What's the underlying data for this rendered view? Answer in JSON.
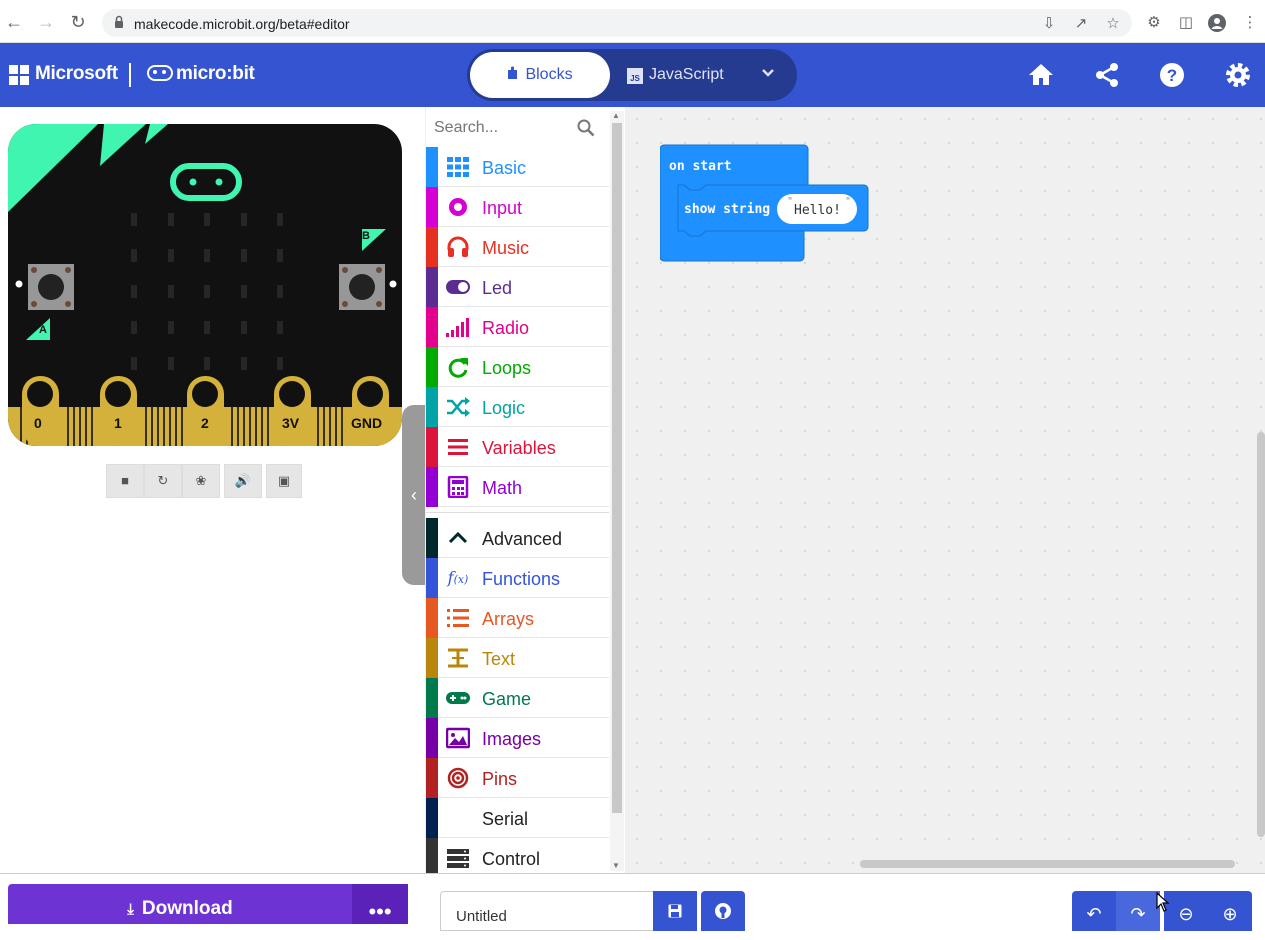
{
  "browser": {
    "url": "makecode.microbit.org/beta#editor"
  },
  "header": {
    "brand": "Microsoft",
    "product": "micro:bit",
    "mode_blocks": "Blocks",
    "mode_js": "JavaScript",
    "js_badge": "JS"
  },
  "simulator": {
    "button_a": "A",
    "button_b": "B",
    "pins": [
      "0",
      "1",
      "2",
      "3V",
      "GND"
    ],
    "accent_color": "#3ff5b0"
  },
  "toolbox": {
    "search_placeholder": "Search...",
    "categories": [
      {
        "label": "Basic",
        "color": "#1e90ff",
        "icon": "grid-icon"
      },
      {
        "label": "Input",
        "color": "#d400d4",
        "icon": "input-icon"
      },
      {
        "label": "Music",
        "color": "#e63022",
        "icon": "headphones-icon"
      },
      {
        "label": "Led",
        "color": "#5c2d91",
        "icon": "toggle-icon"
      },
      {
        "label": "Radio",
        "color": "#e3008c",
        "icon": "signal-icon"
      },
      {
        "label": "Loops",
        "color": "#00aa00",
        "icon": "refresh-icon"
      },
      {
        "label": "Logic",
        "color": "#00a4a6",
        "icon": "shuffle-icon"
      },
      {
        "label": "Variables",
        "color": "#dc143c",
        "icon": "list-icon"
      },
      {
        "label": "Math",
        "color": "#9400d3",
        "icon": "calculator-icon"
      },
      {
        "label": "Advanced",
        "color": "#00272b",
        "icon": "chevron-up-icon"
      },
      {
        "label": "Functions",
        "color": "#3455db",
        "icon": "function-icon"
      },
      {
        "label": "Arrays",
        "color": "#e65722",
        "icon": "numbered-list-icon"
      },
      {
        "label": "Text",
        "color": "#b8860b",
        "icon": "text-icon"
      },
      {
        "label": "Game",
        "color": "#007a4b",
        "icon": "gamepad-icon"
      },
      {
        "label": "Images",
        "color": "#7600a8",
        "icon": "image-icon"
      },
      {
        "label": "Pins",
        "color": "#b22222",
        "icon": "target-icon"
      },
      {
        "label": "Serial",
        "color": "#002050",
        "icon": "serial-icon"
      },
      {
        "label": "Control",
        "color": "#333333",
        "icon": "server-icon"
      }
    ]
  },
  "workspace": {
    "event_block": "on start",
    "statement_block": "show string",
    "string_value": "Hello!",
    "block_color": "#1e90ff"
  },
  "bottom": {
    "download_label": "Download",
    "project_name": "Untitled"
  }
}
